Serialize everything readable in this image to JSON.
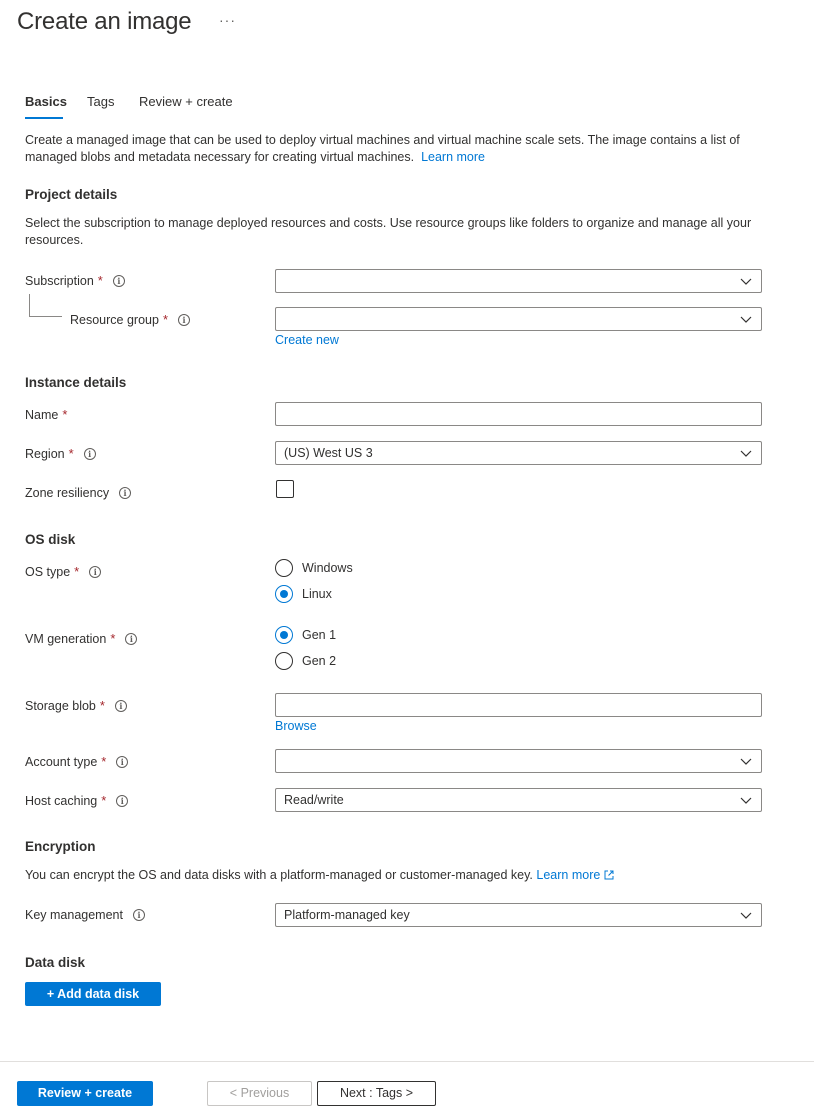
{
  "header": {
    "title": "Create an image",
    "more_label": "···"
  },
  "tabs": [
    {
      "label": "Basics"
    },
    {
      "label": "Tags"
    },
    {
      "label": "Review + create"
    }
  ],
  "intro": {
    "text": "Create a managed image that can be used to deploy virtual machines and virtual machine scale sets. The image contains a list of managed blobs and metadata necessary for creating virtual machines.",
    "learn_more": "Learn more"
  },
  "project": {
    "heading": "Project details",
    "description": "Select the subscription to manage deployed resources and costs. Use resource groups like folders to organize and manage all your resources.",
    "subscription_label": "Subscription",
    "subscription_value": "",
    "resource_group_label": "Resource group",
    "resource_group_value": "",
    "create_new": "Create new"
  },
  "instance": {
    "heading": "Instance details",
    "name_label": "Name",
    "name_value": "",
    "region_label": "Region",
    "region_value": "(US) West US 3",
    "zone_label": "Zone resiliency"
  },
  "os_disk": {
    "heading": "OS disk",
    "os_type_label": "OS type",
    "os_options": [
      "Windows",
      "Linux"
    ],
    "vm_gen_label": "VM generation",
    "vm_gen_options": [
      "Gen 1",
      "Gen 2"
    ],
    "storage_blob_label": "Storage blob",
    "storage_blob_value": "",
    "browse": "Browse",
    "account_type_label": "Account type",
    "account_type_value": "",
    "host_caching_label": "Host caching",
    "host_caching_value": "Read/write"
  },
  "encryption": {
    "heading": "Encryption",
    "description": "You can encrypt the OS and data disks with a platform-managed or customer-managed key.",
    "learn_more": "Learn more",
    "key_mgmt_label": "Key management",
    "key_mgmt_value": "Platform-managed key"
  },
  "data_disk": {
    "heading": "Data disk",
    "add_button": "+ Add data disk"
  },
  "footer": {
    "review_create": "Review + create",
    "previous": "< Previous",
    "next": "Next : Tags >"
  },
  "colors": {
    "accent": "#0078d4",
    "required": "#a4262c",
    "text": "#323130"
  }
}
